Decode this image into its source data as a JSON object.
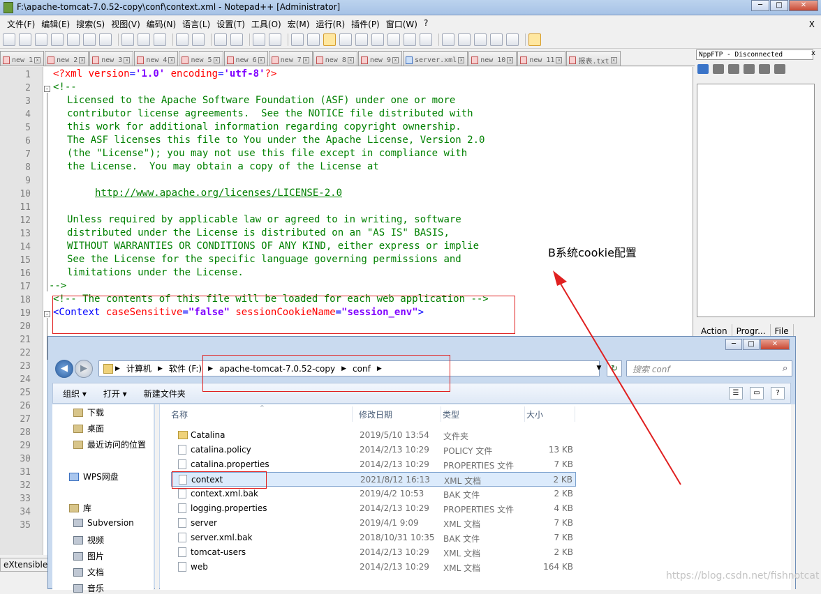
{
  "window": {
    "title": "F:\\apache-tomcat-7.0.52-copy\\conf\\context.xml - Notepad++ [Administrator]"
  },
  "menu": [
    "文件(F)",
    "编辑(E)",
    "搜索(S)",
    "视图(V)",
    "编码(N)",
    "语言(L)",
    "设置(T)",
    "工具(O)",
    "宏(M)",
    "运行(R)",
    "插件(P)",
    "窗口(W)",
    "?"
  ],
  "menu_close": "X",
  "tabs": [
    {
      "label": "new 1",
      "kind": "red"
    },
    {
      "label": "new 2",
      "kind": "red"
    },
    {
      "label": "new 3",
      "kind": "red"
    },
    {
      "label": "new 4",
      "kind": "red"
    },
    {
      "label": "new 5",
      "kind": "red"
    },
    {
      "label": "new 6",
      "kind": "red"
    },
    {
      "label": "new 7",
      "kind": "red"
    },
    {
      "label": "new 8",
      "kind": "red"
    },
    {
      "label": "new 9",
      "kind": "red"
    },
    {
      "label": "server.xml",
      "kind": "blue"
    },
    {
      "label": "new 10",
      "kind": "red"
    },
    {
      "label": "new 11",
      "kind": "red"
    },
    {
      "label": "报表.txt",
      "kind": "red"
    }
  ],
  "editor": {
    "line_numbers": [
      "1",
      "2",
      "3",
      "4",
      "5",
      "6",
      "7",
      "8",
      "9",
      "10",
      "11",
      "12",
      "13",
      "14",
      "15",
      "16",
      "17",
      "18",
      "19",
      "20",
      "21",
      "22",
      "23",
      "24",
      "25",
      "26",
      "27",
      "28",
      "29",
      "30",
      "31",
      "32",
      "33",
      "34",
      "35"
    ],
    "line1": {
      "pi_open": "<?xml ",
      "attr1": "version",
      "eq1": "=",
      "val1": "'1.0'",
      "sp": " ",
      "attr2": "encoding",
      "eq2": "=",
      "val2": "'utf-8'",
      "pi_close": "?>"
    },
    "comment_open": "<!--",
    "license_lines": [
      "Licensed to the Apache Software Foundation (ASF) under one or more",
      "contributor license agreements.  See the NOTICE file distributed with",
      "this work for additional information regarding copyright ownership.",
      "The ASF licenses this file to You under the Apache License, Version 2.0",
      "(the \"License\"); you may not use this file except in compliance with",
      "the License.  You may obtain a copy of the License at"
    ],
    "license_url": "http://www.apache.org/licenses/LICENSE-2.0",
    "license_lines_2": [
      "Unless required by applicable law or agreed to in writing, software",
      "distributed under the License is distributed on an \"AS IS\" BASIS,",
      "WITHOUT WARRANTIES OR CONDITIONS OF ANY KIND, either express or implie",
      "See the License for the specific language governing permissions and",
      "limitations under the License."
    ],
    "comment_close": "-->",
    "line18": "<!-- The contents of this file will be loaded for each web application -->",
    "line19": {
      "open": "<Context ",
      "attr1": "caseSensitive",
      "eq1": "=",
      "val1": "\"false\"",
      "sp": " ",
      "attr2": "sessionCookieName",
      "eq2": "=",
      "val2": "\"session_env\"",
      "close": ">"
    }
  },
  "annotation": "B系统cookie配置",
  "npp_ftp": {
    "title": "NppFTP - Disconnected",
    "close": "x",
    "columns": [
      "Action",
      "Progr...",
      "File"
    ]
  },
  "statusbar": {
    "text": "eXtensible"
  },
  "explorer": {
    "breadcrumb": [
      "计算机",
      "软件 (F:)",
      "apache-tomcat-7.0.52-copy",
      "conf"
    ],
    "search_placeholder": "搜索 conf",
    "commands": [
      "组织 ▾",
      "打开 ▾",
      "新建文件夹"
    ],
    "nav_items": [
      {
        "label": "下载",
        "icon": "download-folder-icon"
      },
      {
        "label": "桌面",
        "icon": "desktop-icon"
      },
      {
        "label": "最近访问的位置",
        "icon": "recent-places-icon"
      },
      {
        "label": "WPS网盘",
        "icon": "cloud-icon"
      },
      {
        "label": "库",
        "icon": "library-icon"
      },
      {
        "label": "Subversion",
        "icon": "subversion-icon"
      },
      {
        "label": "视频",
        "icon": "video-icon"
      },
      {
        "label": "图片",
        "icon": "picture-icon"
      },
      {
        "label": "文档",
        "icon": "document-icon"
      },
      {
        "label": "音乐",
        "icon": "music-icon"
      }
    ],
    "columns": [
      "名称",
      "修改日期",
      "类型",
      "大小"
    ],
    "files": [
      {
        "name": "Catalina",
        "date": "2019/5/10 13:54",
        "type": "文件夹",
        "size": "",
        "folder": true
      },
      {
        "name": "catalina.policy",
        "date": "2014/2/13 10:29",
        "type": "POLICY 文件",
        "size": "13 KB"
      },
      {
        "name": "catalina.properties",
        "date": "2014/2/13 10:29",
        "type": "PROPERTIES 文件",
        "size": "7 KB"
      },
      {
        "name": "context",
        "date": "2021/8/12 16:13",
        "type": "XML 文档",
        "size": "2 KB",
        "selected": true
      },
      {
        "name": "context.xml.bak",
        "date": "2019/4/2 10:53",
        "type": "BAK 文件",
        "size": "2 KB"
      },
      {
        "name": "logging.properties",
        "date": "2014/2/13 10:29",
        "type": "PROPERTIES 文件",
        "size": "4 KB"
      },
      {
        "name": "server",
        "date": "2019/4/1 9:09",
        "type": "XML 文档",
        "size": "7 KB"
      },
      {
        "name": "server.xml.bak",
        "date": "2018/10/31 10:35",
        "type": "BAK 文件",
        "size": "7 KB"
      },
      {
        "name": "tomcat-users",
        "date": "2014/2/13 10:29",
        "type": "XML 文档",
        "size": "2 KB"
      },
      {
        "name": "web",
        "date": "2014/2/13 10:29",
        "type": "XML 文档",
        "size": "164 KB"
      }
    ]
  },
  "watermark": "https://blog.csdn.net/fishnotcat",
  "colors": {
    "annotation_box": "#e02020",
    "arrow": "#e02020"
  }
}
